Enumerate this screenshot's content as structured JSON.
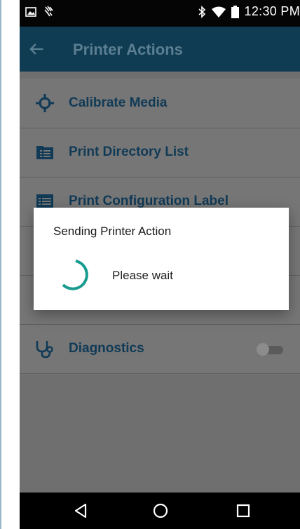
{
  "status_bar": {
    "time": "12:30 PM"
  },
  "app_bar": {
    "title": "Printer Actions"
  },
  "list": {
    "items": [
      {
        "label": "Calibrate Media",
        "icon": "crosshair-icon"
      },
      {
        "label": "Print Directory List",
        "icon": "directory-list-icon"
      },
      {
        "label": "Print Configuration Label",
        "icon": "configuration-label-icon"
      },
      {
        "label": "",
        "icon": ""
      },
      {
        "label": "",
        "icon": ""
      },
      {
        "label": "Diagnostics",
        "icon": "stethoscope-icon",
        "toggle": "off"
      }
    ]
  },
  "dialog": {
    "title": "Sending Printer Action",
    "message": "Please wait"
  },
  "colors": {
    "app_bar": "#0f3c52",
    "label": "#103a56",
    "spinner": "#179b8f",
    "scrim_list": "#767676"
  }
}
